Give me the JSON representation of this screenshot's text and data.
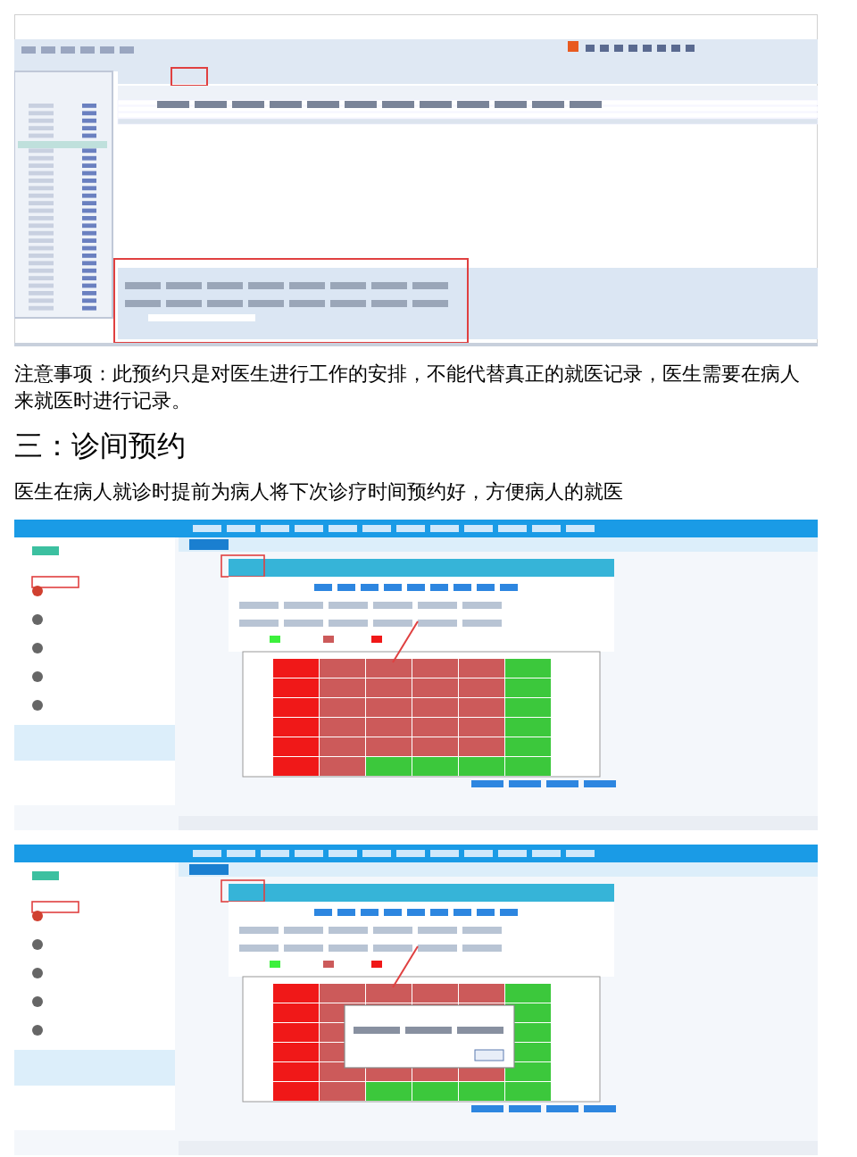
{
  "blocks": [
    {
      "kind": "window"
    },
    {
      "kind": "paragraph",
      "text": "注意事项：此预约只是对医生进行工作的安排，不能代替真正的就医记录，医生需要在病人来就医时进行记录。"
    },
    {
      "kind": "heading",
      "text": "三：诊间预约"
    },
    {
      "kind": "paragraph",
      "text": "医生在病人就诊时提前为病人将下次诊疗时间预约好，方便病人的就医"
    },
    {
      "kind": "schedule"
    },
    {
      "kind": "message"
    }
  ]
}
